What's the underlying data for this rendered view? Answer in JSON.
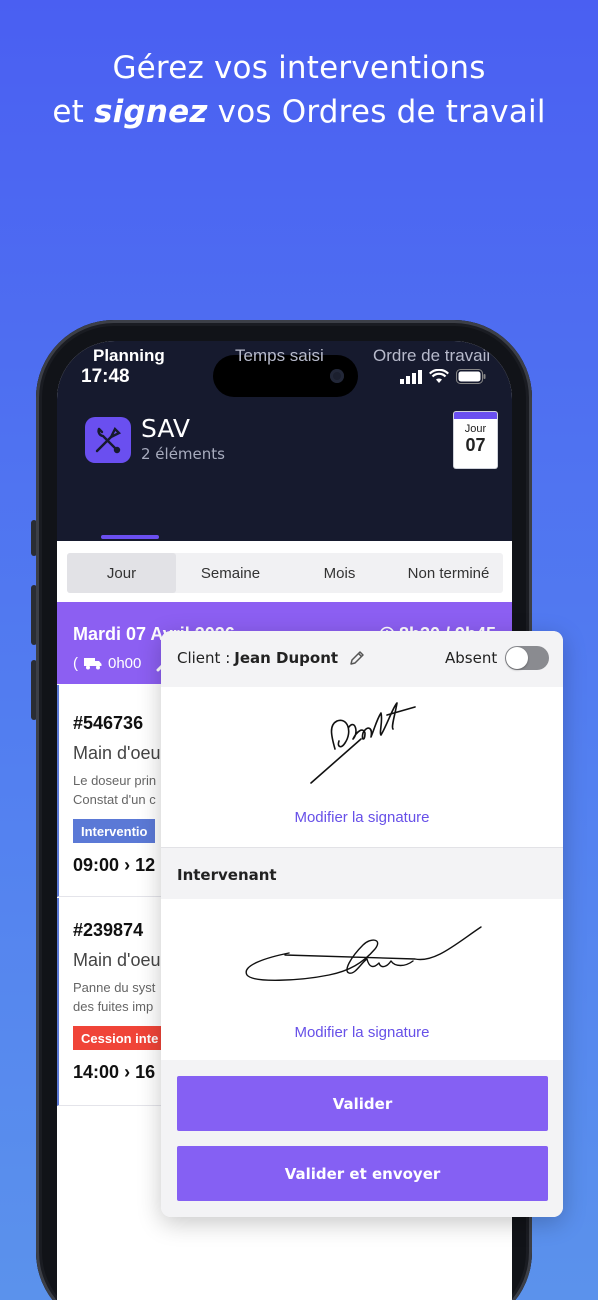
{
  "headline": {
    "line1": "Gérez vos interventions",
    "line2_pre": "et ",
    "line2_em": "signez",
    "line2_post": " vos Ordres de travail"
  },
  "status_bar": {
    "time": "17:48"
  },
  "app": {
    "title": "SAV",
    "subtitle": "2 éléments",
    "calendar": {
      "label": "Jour",
      "day": "07"
    }
  },
  "tabs": [
    {
      "label": "Planning",
      "active": true
    },
    {
      "label": "Temps saisi",
      "active": false
    },
    {
      "label": "Ordre de travail",
      "active": false
    }
  ],
  "segments": [
    {
      "label": "Jour",
      "active": true
    },
    {
      "label": "Semaine",
      "active": false
    },
    {
      "label": "Mois",
      "active": false
    },
    {
      "label": "Non terminé",
      "active": false
    }
  ],
  "day": {
    "title": "Mardi 07 Avril 2026",
    "time_range": "8h30 / 9h45",
    "travel": "0h00"
  },
  "cards": [
    {
      "number": "#546736",
      "title": "Main d'oeu",
      "desc1": "Le doseur prin",
      "desc2": "Constat d'un c",
      "badge": "Interventio",
      "badge_color": "#5b79d6",
      "hours_start": "09:00",
      "hours_end": "12"
    },
    {
      "number": "#239874",
      "title": "Main d'oeu",
      "desc1": "Panne du syst",
      "desc2": "des fuites imp",
      "badge": "Cession inte",
      "badge_color": "#f04438",
      "hours_start": "14:00",
      "hours_end": "16"
    }
  ],
  "modal": {
    "client_label": "Client : ",
    "client_name": "Jean Dupont",
    "absent_label": "Absent",
    "absent_on": false,
    "modify_link_1": "Modifier la signature",
    "section_label": "Intervenant",
    "modify_link_2": "Modifier la signature",
    "btn_validate": "Valider",
    "btn_validate_send": "Valider et envoyer"
  },
  "colors": {
    "accent": "#8560f3",
    "header_dark": "#161a2e",
    "link": "#6750e8"
  }
}
